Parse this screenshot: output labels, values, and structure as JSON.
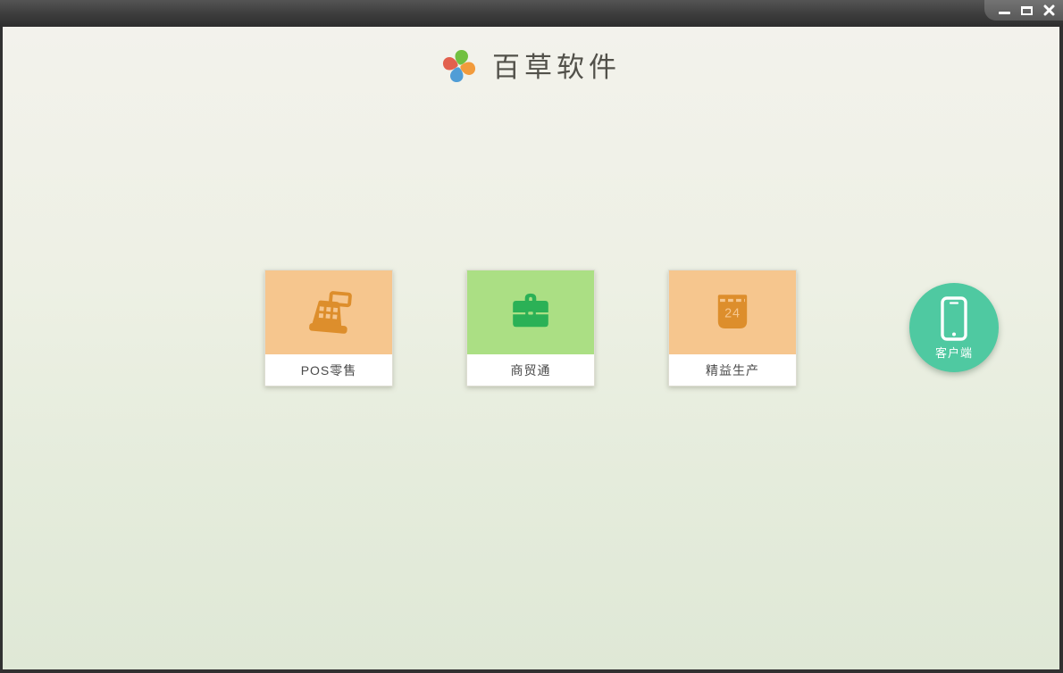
{
  "window": {
    "controls": [
      {
        "name": "minimize"
      },
      {
        "name": "maximize"
      },
      {
        "name": "close"
      }
    ],
    "titlebar_color": "#3c3c3c"
  },
  "brand": {
    "title": "百草软件",
    "logo_icon": "pinwheel-icon",
    "logo_colors": {
      "top": "#72c041",
      "right": "#f29b3c",
      "bottom": "#509dd6",
      "left": "#e2604d"
    }
  },
  "products": [
    {
      "label": "POS零售",
      "icon": "cash-register-icon",
      "tile_color": "#f6c68e",
      "icon_color": "#dd8e2c"
    },
    {
      "label": "商贸通",
      "icon": "briefcase-icon",
      "tile_color": "#abdf84",
      "icon_color": "#2bb156"
    },
    {
      "label": "精益生产",
      "icon": "calendar-icon",
      "calendar_day": "24",
      "tile_color": "#f6c68e",
      "icon_color": "#dd8e2c"
    }
  ],
  "client": {
    "label": "客户端",
    "icon": "smartphone-icon",
    "color": "#4fc9a1"
  },
  "background": {
    "top": "#f3f2ec",
    "bottom": "#dfe8d6"
  }
}
